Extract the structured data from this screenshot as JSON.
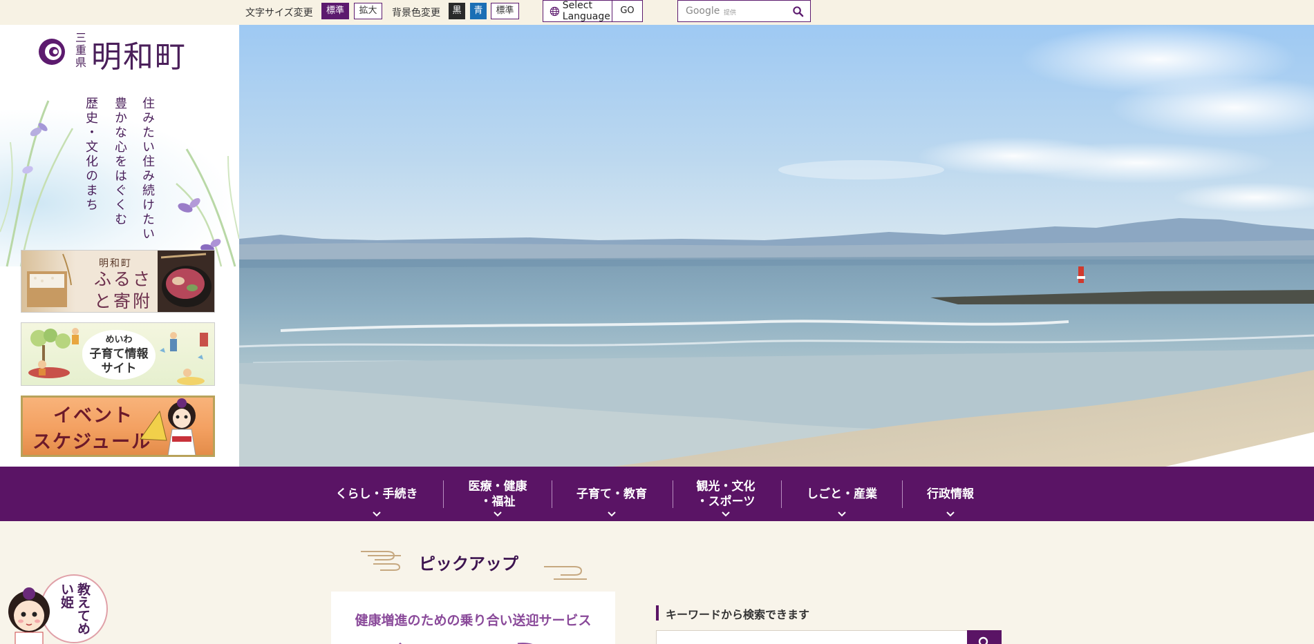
{
  "topbar": {
    "font_size_label": "文字サイズ変更",
    "font_size_standard": "標準",
    "font_size_large": "拡大",
    "bg_color_label": "背景色変更",
    "bg_black": "黒",
    "bg_blue": "青",
    "bg_standard": "標準",
    "language": {
      "select_label": "Select Language",
      "go_label": "GO"
    },
    "google_search": {
      "brand": "Google",
      "provided": "提供"
    }
  },
  "header": {
    "prefecture": "三重県",
    "town_name": "明和町",
    "tagline": [
      "住みたい住み続けたい",
      "豊かな心をはぐくむ",
      "歴史・文化のまち"
    ]
  },
  "sidebar_banners": [
    {
      "small": "明和町",
      "title": "ふるさと寄附"
    },
    {
      "line1": "めいわ",
      "line2": "子育て情報",
      "line3": "サイト"
    },
    {
      "line1": "イベント",
      "line2": "スケジュール"
    }
  ],
  "nav": {
    "items": [
      {
        "label": "くらし・手続き"
      },
      {
        "label": "医療・健康",
        "label2": "・福祉"
      },
      {
        "label": "子育て・教育"
      },
      {
        "label": "観光・文化",
        "label2": "・スポーツ"
      },
      {
        "label": "しごと・産業"
      },
      {
        "label": "行政情報"
      }
    ]
  },
  "pickup": {
    "title": "ピックアップ",
    "card_title": "健康増進のための乗り合い送迎サービス"
  },
  "keyword_search": {
    "title": "キーワードから検索できます"
  },
  "mascot": {
    "text": "教えてめい姫"
  },
  "colors": {
    "brand_purple": "#5a1465",
    "accent_blue": "#1a6fb5",
    "background": "#f8f4ea"
  }
}
